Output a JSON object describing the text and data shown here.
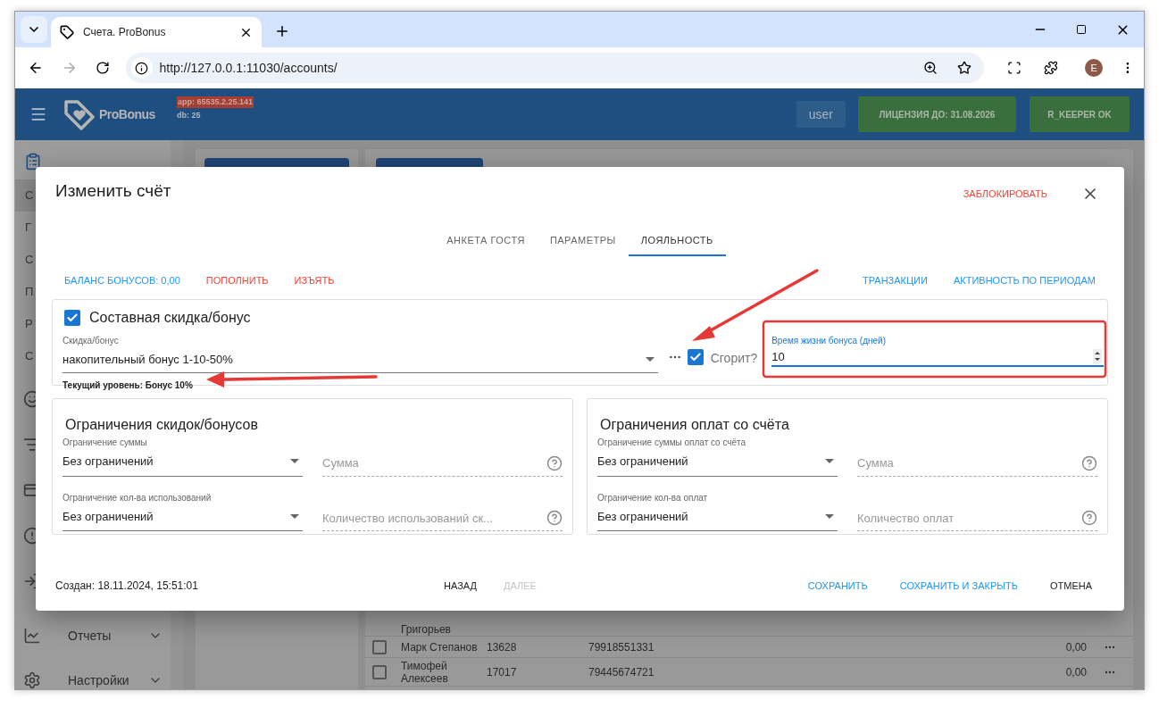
{
  "browser": {
    "tab_title": "Счета. ProBonus",
    "url": "http://127.0.0.1:11030/accounts/",
    "profile_initial": "E"
  },
  "header": {
    "brand": "ProBonus",
    "app_version": "app: 65535.2.25.141",
    "db_version": "db: 25",
    "user": "user",
    "license": "ЛИЦЕНЗИЯ ДО: 31.08.2026",
    "rkeeper": "R_KEEPER OK"
  },
  "sidebar": {
    "subitems": [
      {
        "label": "С",
        "selected": true
      },
      {
        "label": "Г",
        "selected": false
      },
      {
        "label": "С",
        "selected": false
      },
      {
        "label": "П",
        "selected": false
      },
      {
        "label": "Р",
        "selected": false
      },
      {
        "label": "С",
        "selected": false
      }
    ],
    "menus": [
      {
        "label": "Отчеты",
        "kind": "chart"
      },
      {
        "label": "Настройки",
        "kind": "gear"
      }
    ]
  },
  "table": {
    "rows": [
      {
        "name": "Григорьев"
      },
      {
        "name": "Марк Степанов",
        "column_2": "13628",
        "column_3": "79918551331",
        "column_4": "0,00",
        "checked": false
      },
      {
        "name": "Тимофей Алексеев",
        "column_2": "17017",
        "column_3": "79445674721",
        "column_4": "0,00",
        "checked": false
      }
    ]
  },
  "dialog": {
    "title": "Изменить счёт",
    "block_action": "ЗАБЛОКИРОВАТЬ",
    "tabs": [
      {
        "label": "АНКЕТА ГОСТЯ",
        "selected": false
      },
      {
        "label": "ПАРАМЕТРЫ",
        "selected": false
      },
      {
        "label": "ЛОЯЛЬНОСТЬ",
        "selected": true
      }
    ],
    "links_left": [
      {
        "label": "БАЛАНС БОНУСОВ: 0,00",
        "color": "#2196f3"
      },
      {
        "label": "ПОПОЛНИТЬ",
        "color": "#f44336"
      },
      {
        "label": "ИЗЪЯТЬ",
        "color": "#f44336"
      }
    ],
    "links_right": [
      {
        "label": "ТРАНЗАКЦИИ",
        "color": "#2196f3"
      },
      {
        "label": "АКТИВНОСТЬ ПО ПЕРИОДАМ",
        "color": "#2196f3"
      }
    ],
    "composite": {
      "label": "Составная скидка/бонус",
      "checked": true,
      "discount": {
        "label": "Скидка/бонус",
        "value": "накопительный бонус 1-10-50%",
        "helper": "Текущий уровень: Бонус 10%"
      },
      "burn": {
        "label": "Сгорит?",
        "checked": true
      },
      "lifetime": {
        "label": "Время жизни бонуса (дней)",
        "value": "10"
      }
    },
    "sections": [
      {
        "title": "Ограничения скидок/бонусов",
        "rows": [
          {
            "select_label": "Ограничение суммы",
            "select_value": "Без ограничений",
            "placeholder": "Сумма"
          },
          {
            "select_label": "Ограничение кол-ва использований",
            "select_value": "Без ограничений",
            "placeholder": "Количество использований ск..."
          }
        ]
      },
      {
        "title": "Ограничения оплат со счёта",
        "rows": [
          {
            "select_label": "Ограничение суммы оплат со счёта",
            "select_value": "Без ограничений",
            "placeholder": "Сумма"
          },
          {
            "select_label": "Ограничение кол-ва оплат",
            "select_value": "Без ограничений",
            "placeholder": "Количество оплат"
          }
        ]
      }
    ],
    "created": "Создан: 18.11.2024, 15:51:01",
    "nav_buttons": [
      {
        "label": "НАЗАД",
        "disabled": false
      },
      {
        "label": "ДАЛЕЕ",
        "disabled": true
      }
    ],
    "actions": [
      {
        "label": "СОХРАНИТЬ",
        "kind": "primary"
      },
      {
        "label": "СОХРАНИТЬ И ЗАКРЫТЬ",
        "kind": "primary"
      },
      {
        "label": "ОТМЕНА",
        "kind": "plain"
      }
    ]
  }
}
